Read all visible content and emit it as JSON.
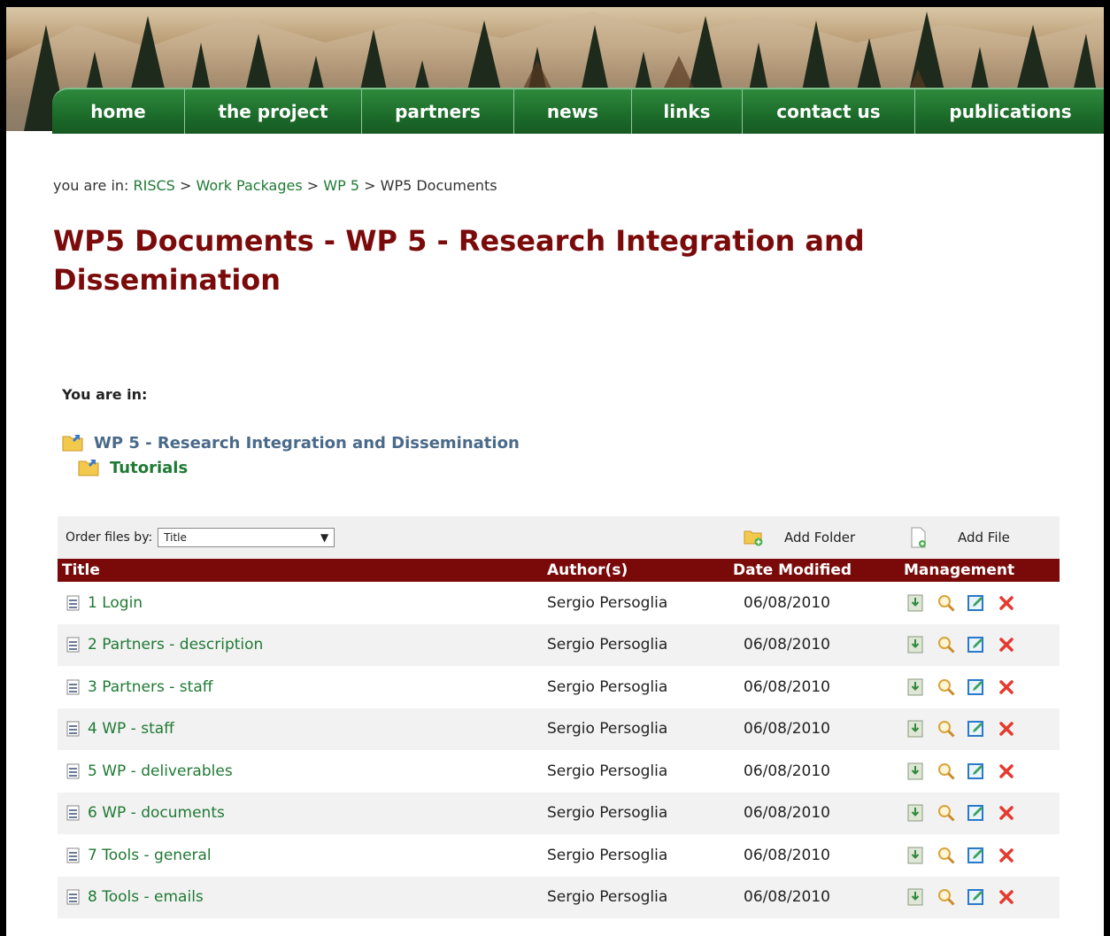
{
  "nav": {
    "items": [
      "home",
      "the project",
      "partners",
      "news",
      "links",
      "contact us",
      "publications"
    ]
  },
  "breadcrumb": {
    "prefix": "you are in:",
    "items": [
      "RISCS",
      "Work Packages",
      "WP 5",
      "WP5 Documents"
    ],
    "separator": ">"
  },
  "page_title": "WP5 Documents - WP 5 - Research Integration and Dissemination",
  "location": {
    "label": "You are in:",
    "folder": "WP 5 - Research Integration and Dissemination",
    "subfolder": "Tutorials"
  },
  "toolbar": {
    "order_label": "Order files by:",
    "order_value": "Title",
    "add_folder": "Add Folder",
    "add_file": "Add File"
  },
  "table": {
    "headers": [
      "Title",
      "Author(s)",
      "Date Modified",
      "Management"
    ],
    "rows": [
      {
        "title": "1 Login",
        "author": "Sergio Persoglia",
        "date": "06/08/2010"
      },
      {
        "title": "2 Partners - description",
        "author": "Sergio Persoglia",
        "date": "06/08/2010"
      },
      {
        "title": "3 Partners - staff",
        "author": "Sergio Persoglia",
        "date": "06/08/2010"
      },
      {
        "title": "4 WP - staff",
        "author": "Sergio Persoglia",
        "date": "06/08/2010"
      },
      {
        "title": "5 WP - deliverables",
        "author": "Sergio Persoglia",
        "date": "06/08/2010"
      },
      {
        "title": "6 WP - documents",
        "author": "Sergio Persoglia",
        "date": "06/08/2010"
      },
      {
        "title": "7 Tools - general",
        "author": "Sergio Persoglia",
        "date": "06/08/2010"
      },
      {
        "title": "8 Tools - emails",
        "author": "Sergio Persoglia",
        "date": "06/08/2010"
      }
    ],
    "management_icons": [
      "download-icon",
      "view-icon",
      "edit-icon",
      "delete-icon"
    ]
  },
  "colors": {
    "nav_green": "#1c6b2a",
    "title_red": "#7b0b0b",
    "header_red": "#7a0a0a",
    "link_green": "#1f7a34"
  }
}
